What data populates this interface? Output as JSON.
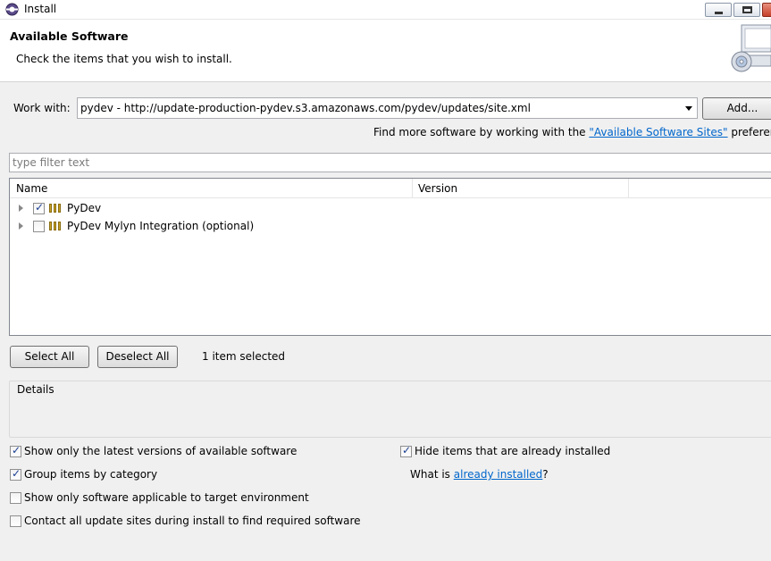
{
  "window": {
    "title": "Install"
  },
  "header": {
    "title": "Available Software",
    "subtitle": "Check the items that you wish to install."
  },
  "work_with": {
    "label": "Work with:",
    "value": "pydev - http://update-production-pydev.s3.amazonaws.com/pydev/updates/site.xml",
    "add_label": "Add...",
    "find_more_prefix": "Find more software by working with the ",
    "find_more_link": "\"Available Software Sites\"",
    "find_more_suffix": " preferences."
  },
  "filter": {
    "placeholder": "type filter text"
  },
  "tree": {
    "columns": [
      "Name",
      "Version"
    ],
    "rows": [
      {
        "name": "PyDev",
        "version": "",
        "checked": true
      },
      {
        "name": "PyDev Mylyn Integration (optional)",
        "version": "",
        "checked": false
      }
    ]
  },
  "actions": {
    "select_all": "Select All",
    "deselect_all": "Deselect All",
    "status": "1 item selected"
  },
  "details": {
    "label": "Details"
  },
  "options": {
    "latest_only": {
      "label": "Show only the latest versions of available software",
      "checked": true
    },
    "group_by_category": {
      "label": "Group items by category",
      "checked": true
    },
    "target_env": {
      "label": "Show only software applicable to target environment",
      "checked": false
    },
    "contact_all": {
      "label": "Contact all update sites during install to find required software",
      "checked": false
    },
    "hide_installed": {
      "label": "Hide items that are already installed",
      "checked": true
    },
    "what_is_prefix": "What is ",
    "what_is_link": "already installed",
    "what_is_suffix": "?"
  },
  "colors": {
    "link": "#0066cc",
    "background": "#f0f0f0"
  }
}
